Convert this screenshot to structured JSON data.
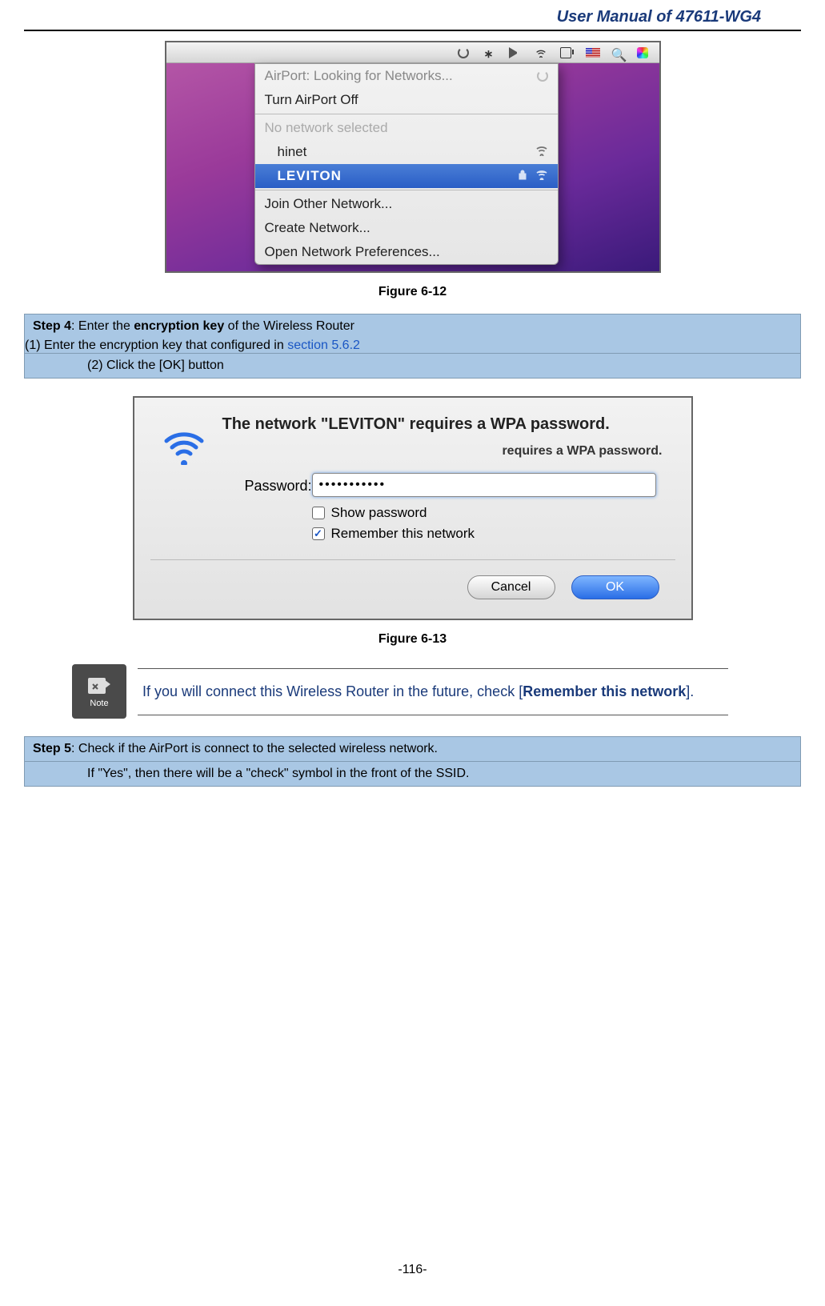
{
  "doc_header": "User Manual of 47611-WG4",
  "fig612": {
    "menubar_icons": [
      "sync",
      "bluetooth",
      "volume",
      "wifi",
      "battery",
      "flag-us",
      "spotlight",
      "color-wheel"
    ],
    "dropdown": {
      "status": "AirPort: Looking for Networks...",
      "toggle": "Turn AirPort Off",
      "no_network": "No network selected",
      "networks": [
        {
          "ssid": "hinet",
          "locked": false,
          "selected": false
        },
        {
          "ssid": "LEVITON",
          "locked": true,
          "selected": true
        }
      ],
      "actions": [
        "Join Other Network...",
        "Create Network...",
        "Open Network Preferences..."
      ]
    },
    "caption": "Figure 6-12"
  },
  "step4": {
    "heading_bold_prefix": "Step 4",
    "heading_rest": ": Enter the ",
    "heading_bold_mid": "encryption key",
    "heading_tail": " of the Wireless Router",
    "item1_prefix": "(1)  Enter the encryption key that configured in ",
    "item1_link": "section 5.6.2",
    "item2": "(2)  Click the [OK] button"
  },
  "fig613": {
    "title": "The network \"LEVITON\" requires a WPA password.",
    "subtitle": "requires a WPA password.",
    "password_label": "Password:",
    "password_value": "•••••••••••",
    "show_pw_label": "Show password",
    "remember_label": "Remember this network",
    "show_pw_checked": false,
    "remember_checked": true,
    "cancel_label": "Cancel",
    "ok_label": "OK",
    "caption": "Figure 6-13"
  },
  "note": {
    "icon_label": "Note",
    "text_pre": "If you will connect this Wireless Router in the future, check [",
    "text_bold": "Remember this network",
    "text_post": "]."
  },
  "step5": {
    "heading_bold_prefix": "Step 5",
    "heading_rest": ": Check if the AirPort is connect to the selected wireless network.",
    "sub": "If \"Yes\", then there will be a \"check\" symbol in the front of the SSID."
  },
  "page_number": "-116-"
}
